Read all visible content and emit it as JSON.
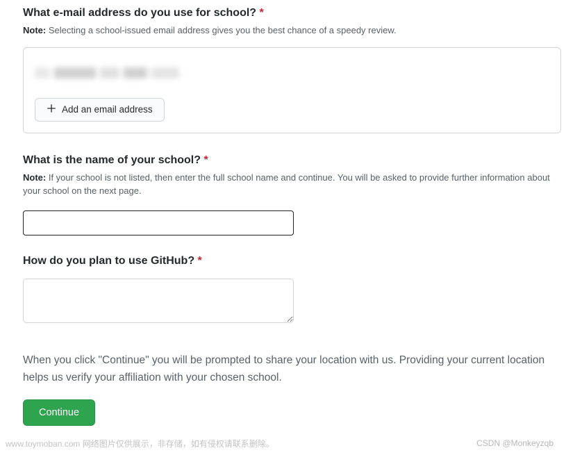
{
  "email_section": {
    "question": "What e-mail address do you use for school?",
    "required_mark": "*",
    "note_label": "Note:",
    "note_text": "Selecting a school-issued email address gives you the best chance of a speedy review.",
    "add_button_label": "Add an email address"
  },
  "school_section": {
    "question": "What is the name of your school?",
    "required_mark": "*",
    "note_label": "Note:",
    "note_text": "If your school is not listed, then enter the full school name and continue. You will be asked to provide further information about your school on the next page.",
    "input_value": ""
  },
  "usage_section": {
    "question": "How do you plan to use GitHub?",
    "required_mark": "*",
    "textarea_value": ""
  },
  "location_text": "When you click \"Continue\" you will be prompted to share your location with us. Providing your current location helps us verify your affiliation with your chosen school.",
  "continue_button_label": "Continue",
  "watermark_left": "www.toymoban.com 网络图片仅供展示，非存储，如有侵权请联系删除。",
  "watermark_right": "CSDN @Monkeyzqb"
}
